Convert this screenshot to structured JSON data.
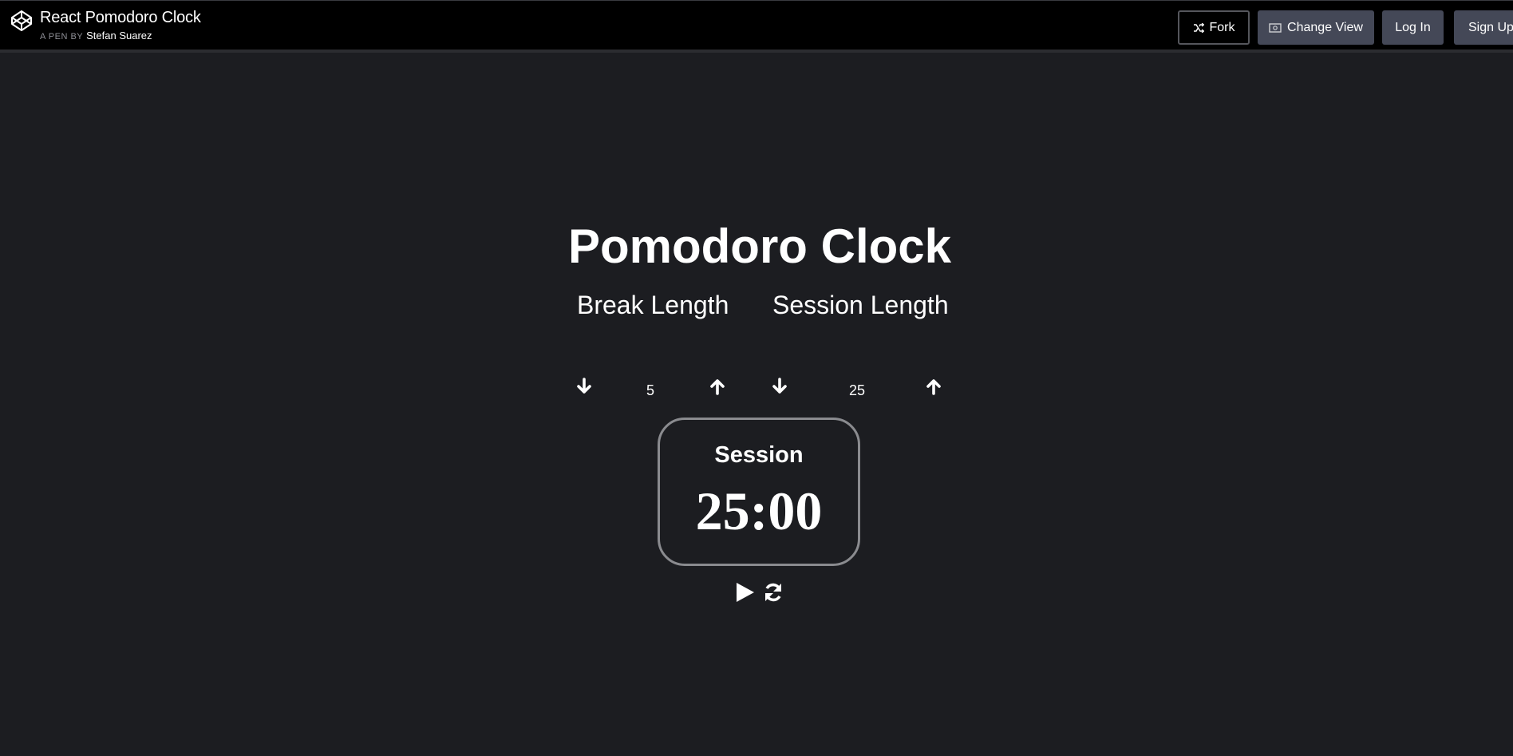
{
  "header": {
    "pen_title": "React Pomodoro Clock",
    "by_label": "A PEN BY",
    "author": "Stefan Suarez",
    "logo_icon": "codepen-logo-icon",
    "buttons": {
      "fork": "Fork",
      "change_view": "Change View",
      "log_in": "Log In",
      "sign_up": "Sign Up"
    }
  },
  "app": {
    "title": "Pomodoro Clock",
    "break": {
      "label": "Break Length",
      "value": "5",
      "decrement_icon": "arrow-down-icon",
      "increment_icon": "arrow-up-icon"
    },
    "session": {
      "label": "Session Length",
      "value": "25",
      "decrement_icon": "arrow-down-icon",
      "increment_icon": "arrow-up-icon"
    },
    "timer": {
      "label": "Session",
      "time": "25:00"
    },
    "controls": {
      "play_icon": "play-icon",
      "reset_icon": "refresh-icon"
    }
  },
  "colors": {
    "page_background": "#1c1d21",
    "topbar_background": "#000000",
    "button_background": "#444857",
    "timer_border": "#8a8b8f",
    "text": "#ffffff"
  }
}
